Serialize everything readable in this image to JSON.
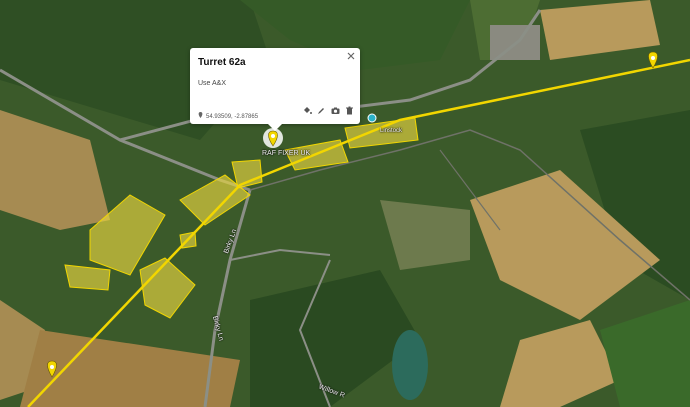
{
  "popup": {
    "title": "Turret 62a",
    "description": "Use A&X",
    "coordinates": "54.93509, -2.87865"
  },
  "map_labels": {
    "building_label": "RAF FIXER UK",
    "road_label_a": "Birky Ln",
    "road_label_b": "Birky Ln",
    "road_label_c": "Willow R",
    "place_label": "Linstock"
  },
  "icons": {
    "marker": "map-pin-icon",
    "paint": "paint-bucket-icon",
    "edit": "pencil-icon",
    "camera": "camera-icon",
    "delete": "trash-icon"
  },
  "colors": {
    "route": "#f2d600",
    "highlight_fill": "#e8d640",
    "field_green": "#3f6a2a",
    "field_tan": "#b89a5c"
  }
}
